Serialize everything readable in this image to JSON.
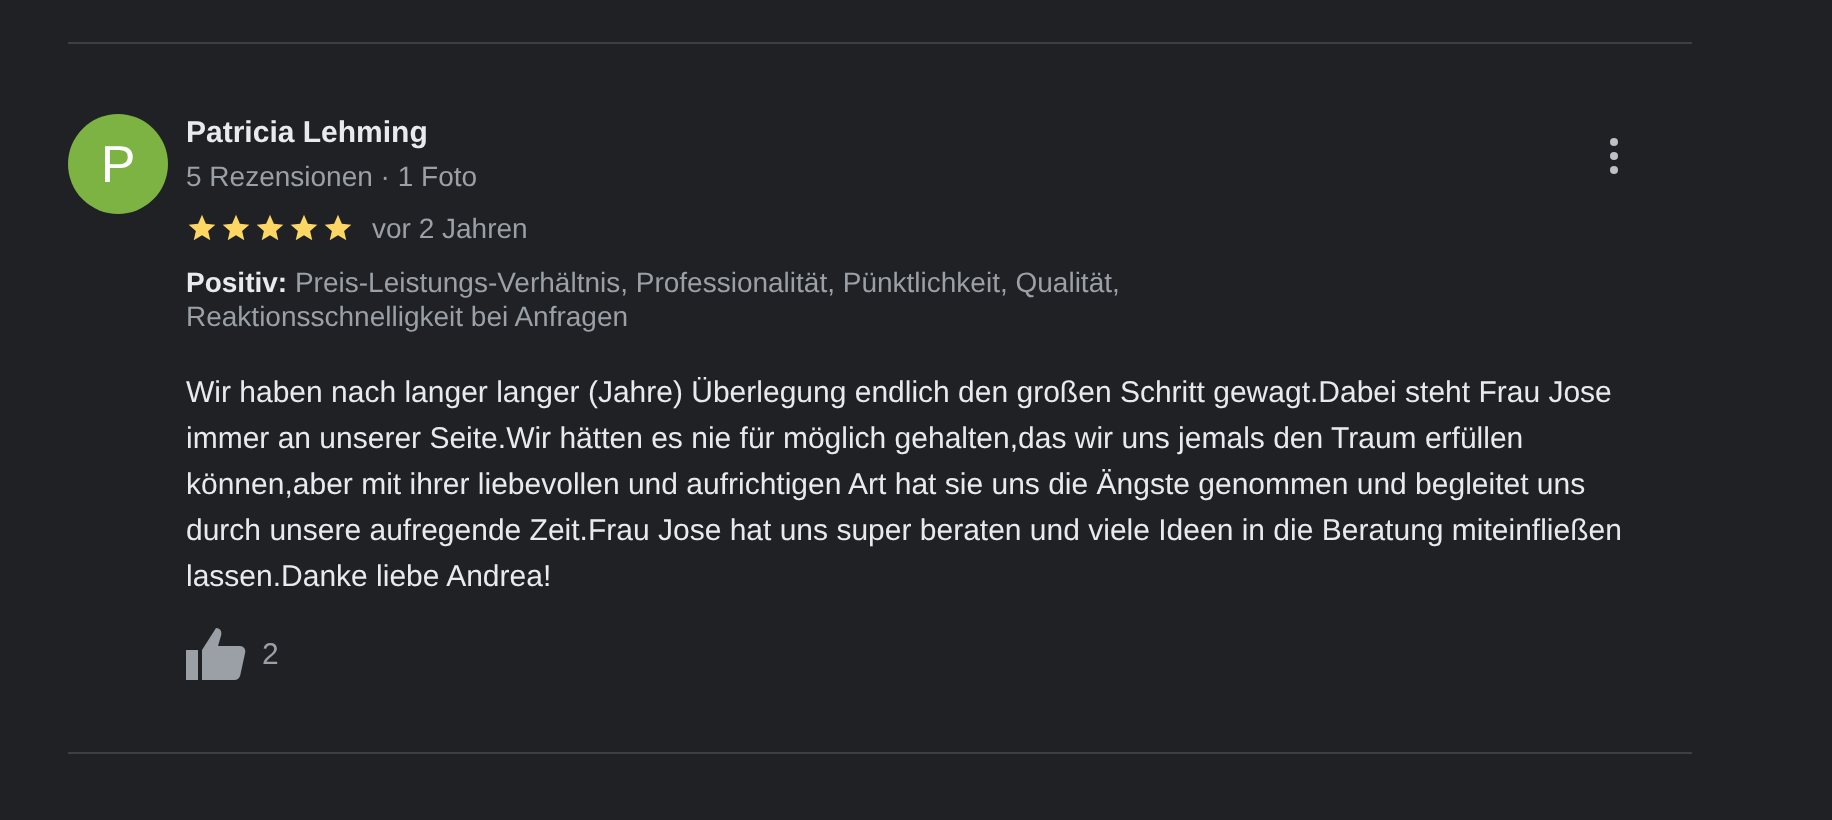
{
  "review": {
    "avatar_letter": "P",
    "author": "Patricia Lehming",
    "author_meta": "5 Rezensionen · 1 Foto",
    "stars": 5,
    "date": "vor 2 Jahren",
    "highlights": "**Positiv:** Preis-Leistungs-Verhältnis, Professionalität, Pünktlichkeit, Qualität, Reaktionsschnelligkeit bei Anfragen",
    "text": "Wir haben nach langer langer (Jahre) Überlegung endlich den großen Schritt gewagt.Dabei steht Frau Jose immer an unserer Seite.Wir hätten es nie für möglich gehalten,das wir uns jemals den Traum erfüllen können,aber mit ihrer liebevollen und aufrichtigen Art hat sie uns die Ängste genommen und begleitet uns durch unsere aufregende Zeit.Frau Jose hat uns super beraten und viele Ideen in die Beratung miteinfließen lassen.Danke liebe Andrea!",
    "likes": "2"
  }
}
